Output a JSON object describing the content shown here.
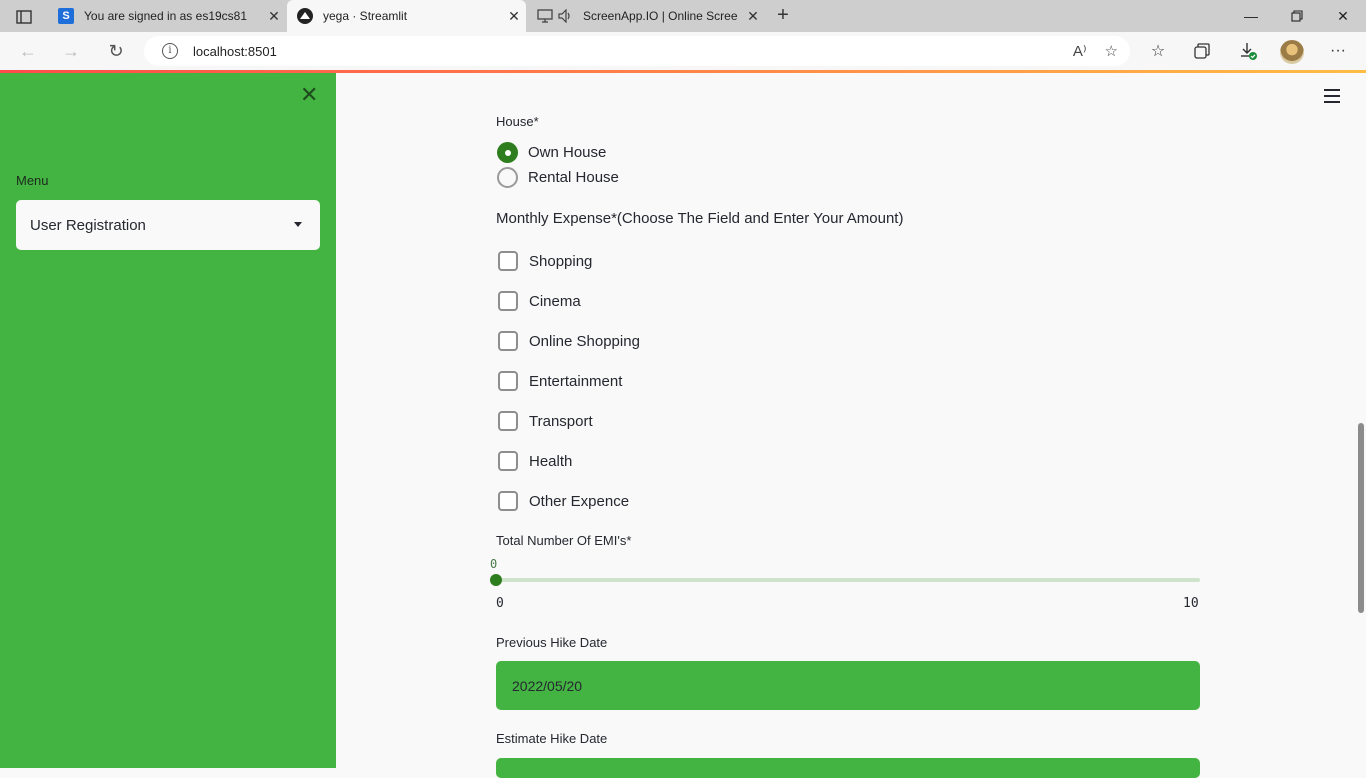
{
  "browser": {
    "tabs": [
      {
        "title": "You are signed in as es19cs81",
        "favicon_letter": "S",
        "favicon_color": "#1e6fd9"
      },
      {
        "title": "yega · Streamlit",
        "favicon_color": "#222222"
      },
      {
        "title": "ScreenApp.IO | Online Scree",
        "favicon_color": "#555555"
      }
    ],
    "url": "localhost:8501"
  },
  "sidebar": {
    "menu_label": "Menu",
    "menu_selected": "User Registration",
    "bg_color": "#43b442"
  },
  "form": {
    "house": {
      "label": "House*",
      "options": [
        {
          "label": "Own House",
          "selected": true
        },
        {
          "label": "Rental House",
          "selected": false
        }
      ]
    },
    "monthly_expense": {
      "title": "Monthly Expense*(Choose The Field and Enter Your Amount)",
      "options": [
        "Shopping",
        "Cinema",
        "Online Shopping",
        "Entertainment",
        "Transport",
        "Health",
        "Other Expence"
      ]
    },
    "emis": {
      "label": "Total Number Of EMI's*",
      "value": "0",
      "min": "0",
      "max": "10"
    },
    "previous_hike": {
      "label": "Previous Hike Date",
      "value": "2022/05/20"
    },
    "estimate_hike": {
      "label": "Estimate Hike Date"
    }
  },
  "colors": {
    "accent": "#2e7d1f",
    "input_bg": "#43b442"
  }
}
